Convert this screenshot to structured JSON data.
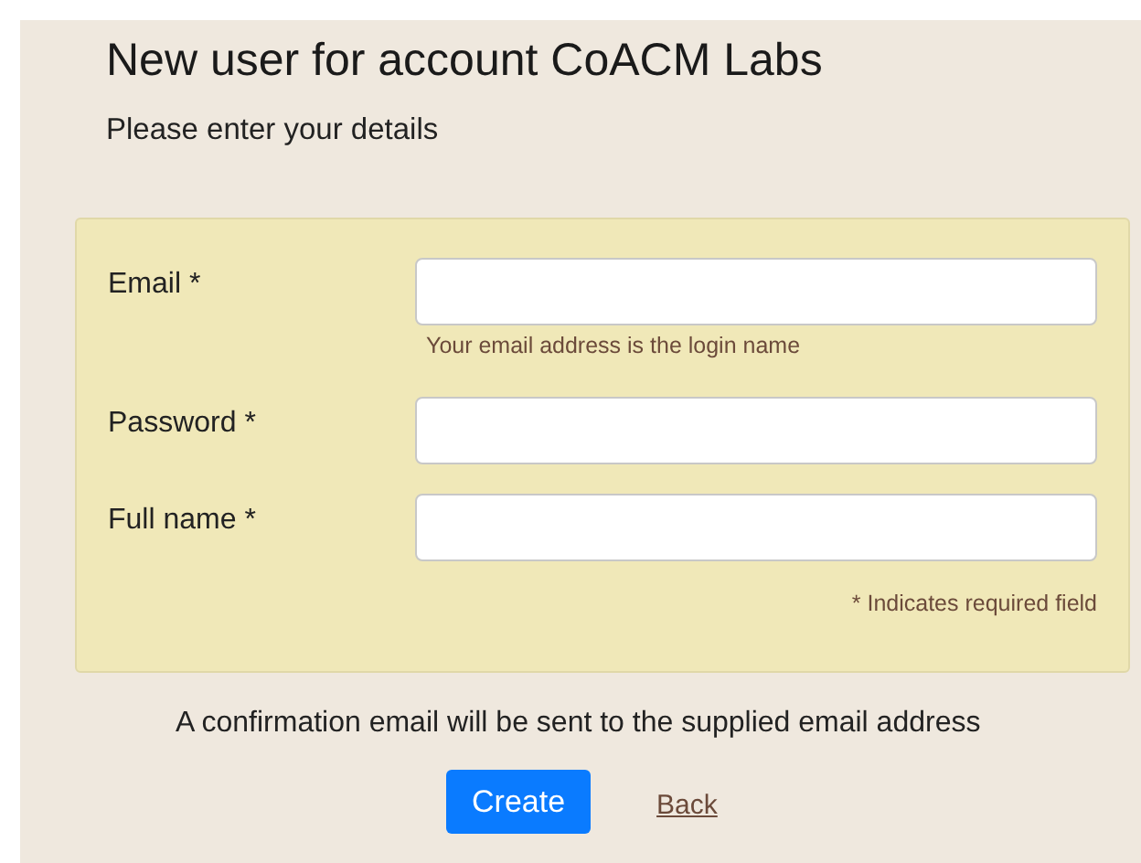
{
  "heading": "New user for account CoACM Labs",
  "subheading": "Please enter your details",
  "fields": [
    {
      "label": "Email *",
      "hint": "Your email address is the login name"
    },
    {
      "label": "Password *"
    },
    {
      "label": "Full name *"
    }
  ],
  "required_note": "* Indicates required field",
  "confirmation": "A confirmation email will be sent to the supplied email address",
  "buttons": [
    {
      "kind": "primary",
      "label": "Create"
    },
    {
      "kind": "link",
      "label": "Back"
    }
  ]
}
